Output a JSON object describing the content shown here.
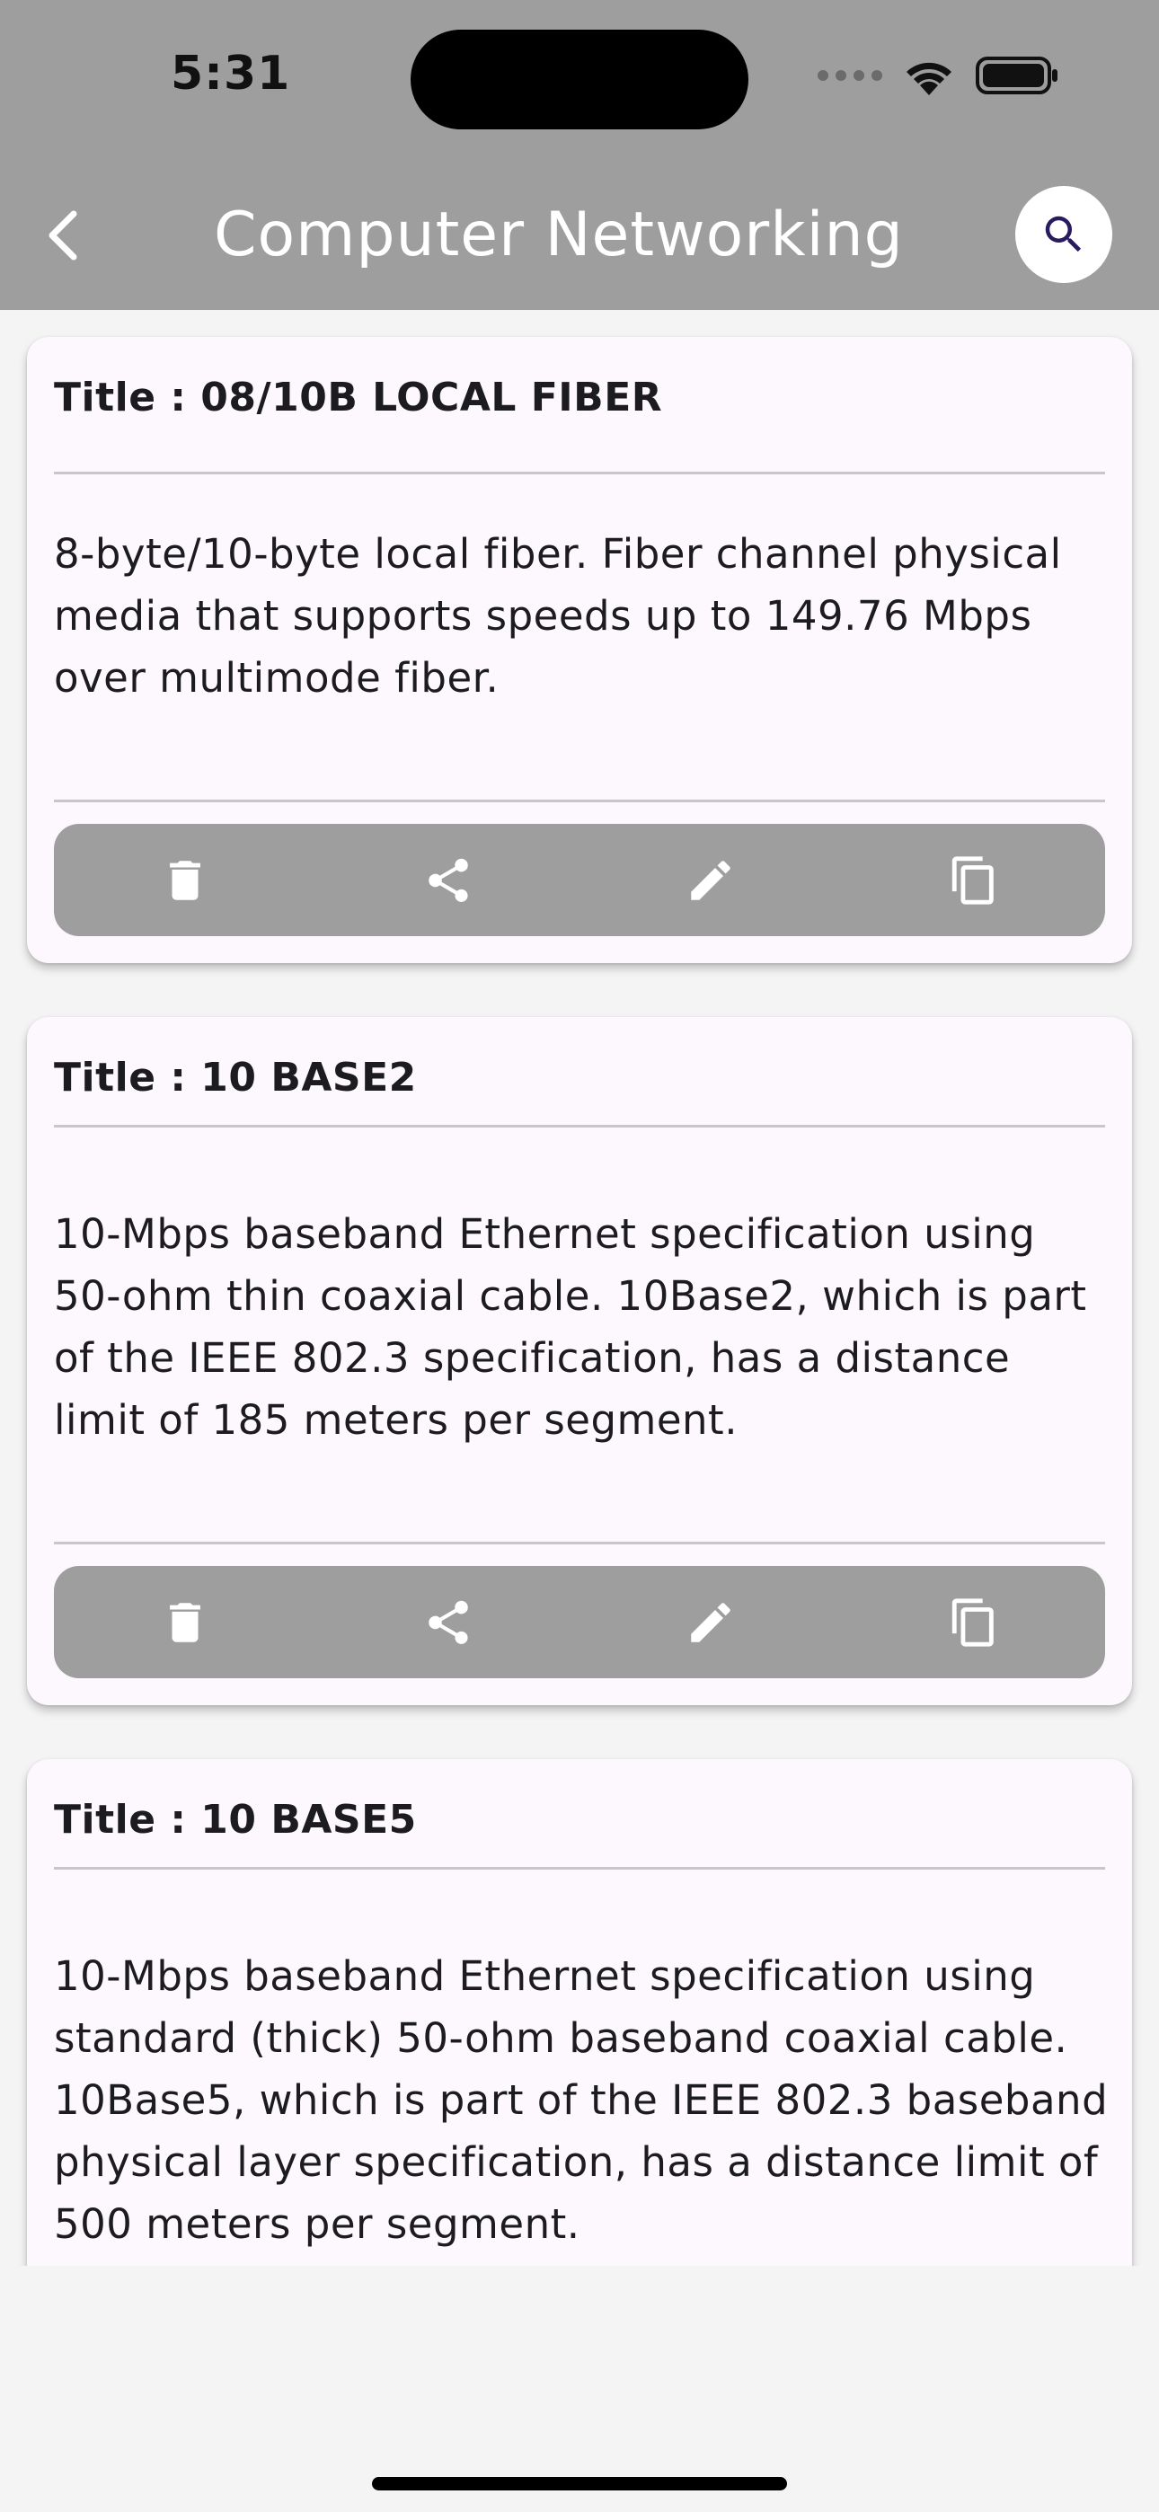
{
  "status_bar": {
    "time": "5:31"
  },
  "app_bar": {
    "title": "Computer Networking ..."
  },
  "cards": [
    {
      "title": "Title : 08/10B LOCAL FIBER",
      "body": "8-byte/10-byte local fiber. Fiber channel physical media that supports speeds up to 149.76 Mbps over multimode fiber."
    },
    {
      "title": "Title : 10 BASE2",
      "body": "10-Mbps baseband Ethernet specification using 50-ohm thin coaxial cable. 10Base2, which is part of the IEEE 802.3 specification, has a distance limit of 185 meters per segment."
    },
    {
      "title": "Title : 10 BASE5",
      "body": "10-Mbps baseband Ethernet specification using standard (thick) 50-ohm baseband coaxial cable. 10Base5, which is part of the IEEE 802.3 baseband physical layer specification, has a distance limit of 500 meters per segment."
    }
  ],
  "icons": {
    "back": "chevron-left-icon",
    "search": "search-icon",
    "actions": [
      "delete-icon",
      "share-icon",
      "edit-icon",
      "copy-icon"
    ]
  },
  "colors": {
    "app_bar": "#9e9e9e",
    "card_background": "#fdf8fd",
    "action_bar": "#9e9e9e",
    "search_icon": "#2a1a5e"
  }
}
